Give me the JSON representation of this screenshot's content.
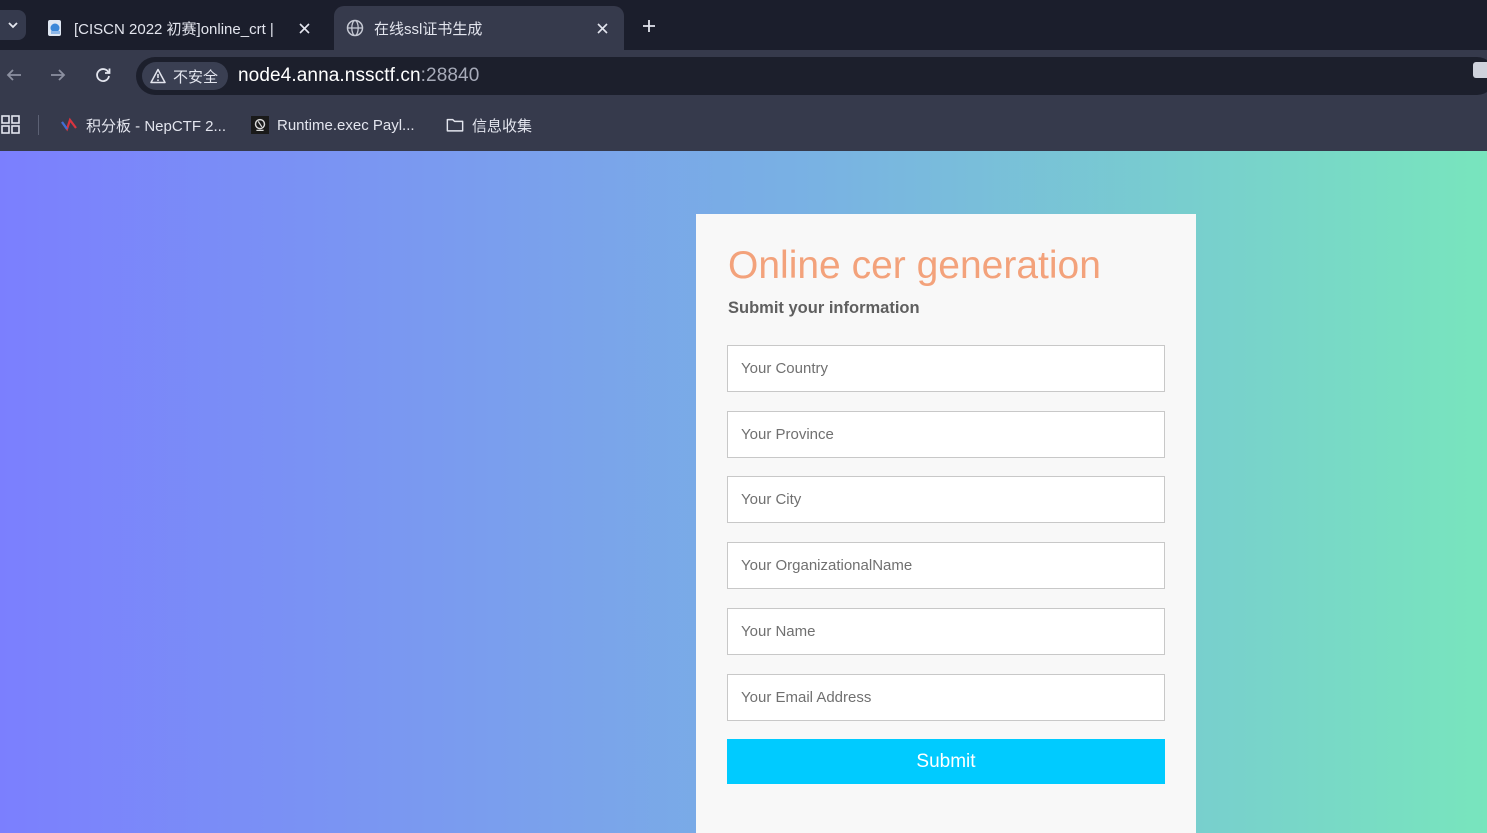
{
  "browser": {
    "tabs": [
      {
        "title": "[CISCN 2022 初赛]online_crt |",
        "active": false
      },
      {
        "title": "在线ssl证书生成",
        "active": true
      }
    ],
    "security_label": "不安全",
    "url_host": "node4.anna.nssctf.cn",
    "url_port": ":28840",
    "bookmarks": [
      {
        "label": "积分板 - NepCTF 2...",
        "icon": "nepctf-favicon"
      },
      {
        "label": "Runtime.exec Payl...",
        "icon": "runtime-favicon"
      },
      {
        "label": "信息收集",
        "icon": "folder-icon"
      }
    ],
    "colors": {
      "tabstrip": "#1b1e2c",
      "toolbar": "#363a4c",
      "omnibox": "#1c1f2c"
    }
  },
  "page": {
    "gradient": [
      "#7b7ffe",
      "#79b2e3",
      "#78e5bd"
    ],
    "form": {
      "title": "Online cer generation",
      "subtitle": "Submit your information",
      "fields": [
        {
          "placeholder": "Your Country",
          "value": ""
        },
        {
          "placeholder": "Your Province",
          "value": ""
        },
        {
          "placeholder": "Your City",
          "value": ""
        },
        {
          "placeholder": "Your OrganizationalName",
          "value": ""
        },
        {
          "placeholder": "Your Name",
          "value": ""
        },
        {
          "placeholder": "Your Email Address",
          "value": ""
        }
      ],
      "submit_label": "Submit",
      "colors": {
        "title": "#f3a27b",
        "submit": "#00cbff",
        "card": "#f8f8f8"
      }
    }
  }
}
